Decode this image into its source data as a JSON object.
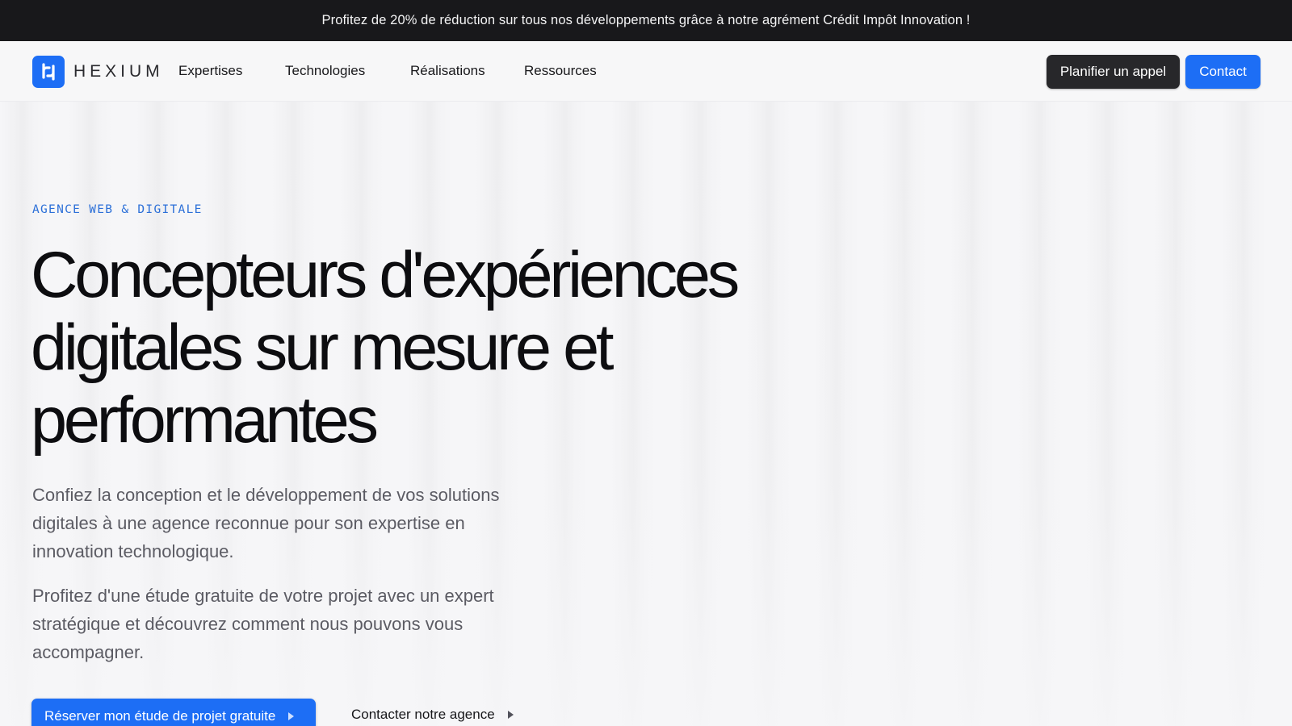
{
  "promo_banner": {
    "text": "Profitez de 20% de réduction sur tous nos développements grâce à notre agrément Crédit Impôt Innovation !"
  },
  "header": {
    "logo_text": "HEXIUM",
    "logo_icon": "hexium-logo-icon",
    "nav": [
      {
        "label": "Expertises"
      },
      {
        "label": "Technologies"
      },
      {
        "label": "Réalisations"
      },
      {
        "label": "Ressources"
      }
    ],
    "call_button_label": "Planifier un appel",
    "contact_button_label": "Contact"
  },
  "hero": {
    "eyebrow": "AGENCE WEB & DIGITALE",
    "headline_line1": "Concepteurs d'expériences",
    "headline_line2": "digitales sur mesure et",
    "headline_line3": "performantes",
    "paragraph_1": "Confiez la conception et le développement de vos solutions digitales à une agence reconnue pour son expertise en innovation technologique.",
    "paragraph_2": "Profitez d'une étude gratuite de votre projet avec un expert stratégique et découvrez comment nous pouvons vous accompagner.",
    "primary_cta_label": "Réserver mon étude de projet gratuite",
    "secondary_cta_label": "Contacter notre agence"
  },
  "colors": {
    "brand_blue": "#1d6ef5",
    "dark_button": "#27272a",
    "promo_background": "#18181b",
    "eyebrow": "#2b6fd8"
  }
}
